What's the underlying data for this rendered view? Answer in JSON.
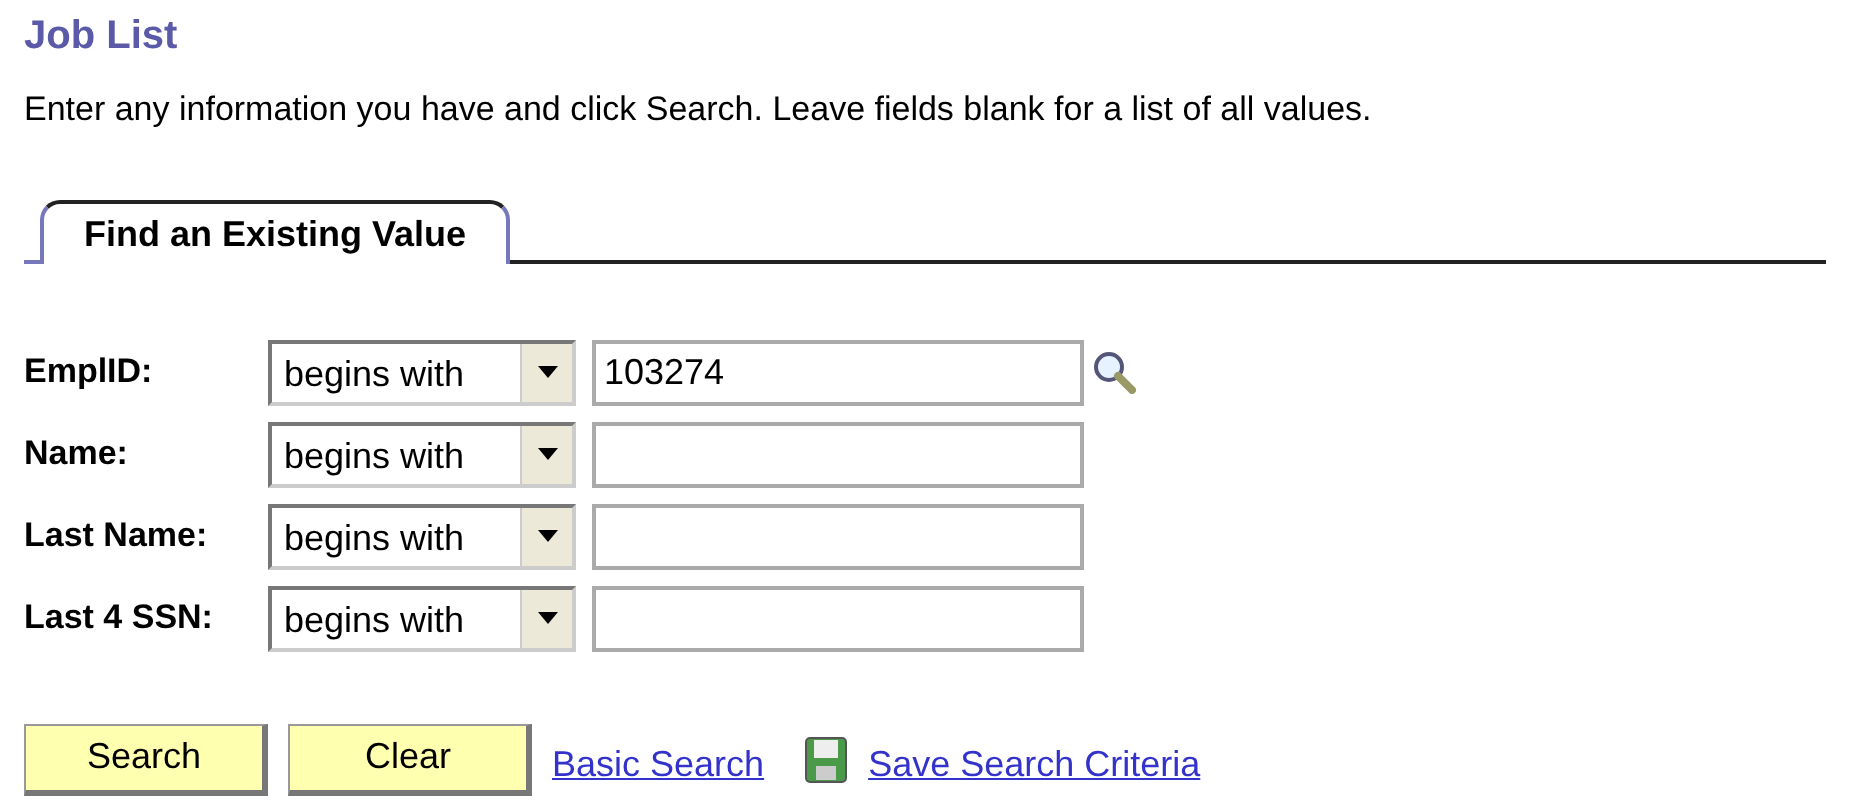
{
  "page_title": "Job List",
  "instructions": "Enter any information you have and click Search. Leave fields blank for a list of all values.",
  "tabs": [
    {
      "label": "Find an Existing Value",
      "selected": true
    }
  ],
  "fields": [
    {
      "label": "EmplID:",
      "operator": "begins with",
      "value": "103274",
      "lookup": true
    },
    {
      "label": "Name:",
      "operator": "begins with",
      "lookup": false
    },
    {
      "label": "Last Name:",
      "operator": "begins with",
      "lookup": false
    },
    {
      "label": "Last 4 SSN:",
      "operator": "begins with",
      "lookup": false
    }
  ],
  "buttons": [
    "Search",
    "Clear"
  ],
  "links": [
    {
      "label": "Basic Search",
      "icon": false
    },
    {
      "label": "Save Search Criteria",
      "icon": true
    }
  ]
}
